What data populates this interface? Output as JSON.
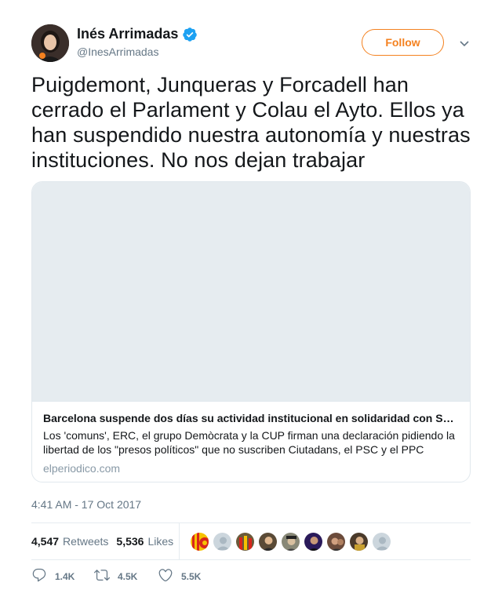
{
  "author": {
    "display_name": "Inés Arrimadas",
    "handle": "@InesArrimadas",
    "verified": true,
    "avatar_icon": "profile-photo"
  },
  "follow_button": {
    "label": "Follow",
    "color": "#f4811f"
  },
  "menu": {
    "icon": "chevron-down-icon"
  },
  "tweet": {
    "text": "Puigdemont, Junqueras y Forcadell han cerrado el Parlament y Colau el Ayto. Ellos ya han suspendido nuestra autonomía y nuestras instituciones. No nos dejan trabajar",
    "timestamp": "4:41 AM - 17 Oct 2017"
  },
  "link_card": {
    "title": "Barcelona suspende dos días su actividad institucional en solidaridad con S…",
    "description": "Los 'comuns', ERC, el grupo Demòcrata y la CUP firman una declaración pidiendo la libertad de los \"presos políticos\" que no suscriben Ciutadans, el PSC y el PPC",
    "domain": "elperiodico.com"
  },
  "stats": {
    "retweets_count": "4,547",
    "retweets_label": "Retweets",
    "likes_count": "5,536",
    "likes_label": "Likes"
  },
  "likers": [
    {
      "icon": "flag-avatar",
      "color": "#f6c200"
    },
    {
      "icon": "default-avatar",
      "color": "#ccd6dd"
    },
    {
      "icon": "photo-avatar",
      "color": "#8b4a2b"
    },
    {
      "icon": "photo-avatar",
      "color": "#5a4a36"
    },
    {
      "icon": "photo-avatar",
      "color": "#777766"
    },
    {
      "icon": "photo-avatar",
      "color": "#3a2a6a"
    },
    {
      "icon": "photo-avatar",
      "color": "#6b4b3b"
    },
    {
      "icon": "photo-avatar",
      "color": "#4a3a2a"
    },
    {
      "icon": "default-avatar",
      "color": "#ccd6dd"
    }
  ],
  "actions": {
    "replies": "1.4K",
    "retweets": "4.5K",
    "likes": "5.5K"
  },
  "colors": {
    "accent": "#f4811f",
    "verified": "#1da1f2",
    "secondary_text": "#657786"
  }
}
